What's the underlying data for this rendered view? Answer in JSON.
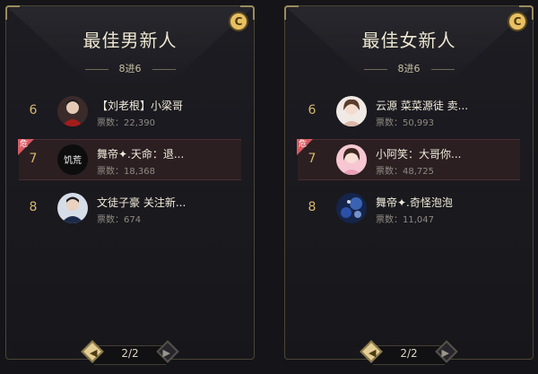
{
  "panels": [
    {
      "title": "最佳男新人",
      "subtitle": "8进6",
      "icon": "c-coin-icon",
      "danger_label": "危",
      "rows": [
        {
          "rank": "6",
          "name": "【刘老根】小梁哥",
          "votes": "票数：22,390",
          "danger": false
        },
        {
          "rank": "7",
          "name": "舞帝✦.天命：退...",
          "votes": "票数：18,368",
          "danger": true
        },
        {
          "rank": "8",
          "name": "文徒子豪 关注新...",
          "votes": "票数：674",
          "danger": false
        }
      ],
      "pager": "2/2"
    },
    {
      "title": "最佳女新人",
      "subtitle": "8进6",
      "icon": "c-coin-icon",
      "danger_label": "危",
      "rows": [
        {
          "rank": "6",
          "name": "云源 菜菜源徒 卖...",
          "votes": "票数：50,993",
          "danger": false
        },
        {
          "rank": "7",
          "name": "小阿笑：大哥你...",
          "votes": "票数：48,725",
          "danger": true
        },
        {
          "rank": "8",
          "name": "舞帝✦.奇怪泡泡",
          "votes": "票数：11,047",
          "danger": false
        }
      ],
      "pager": "2/2"
    }
  ],
  "colors": {
    "accent_gold": "#d7b86c",
    "danger": "#d85a62",
    "background": "#151519"
  },
  "avatar_text": "饥荒"
}
